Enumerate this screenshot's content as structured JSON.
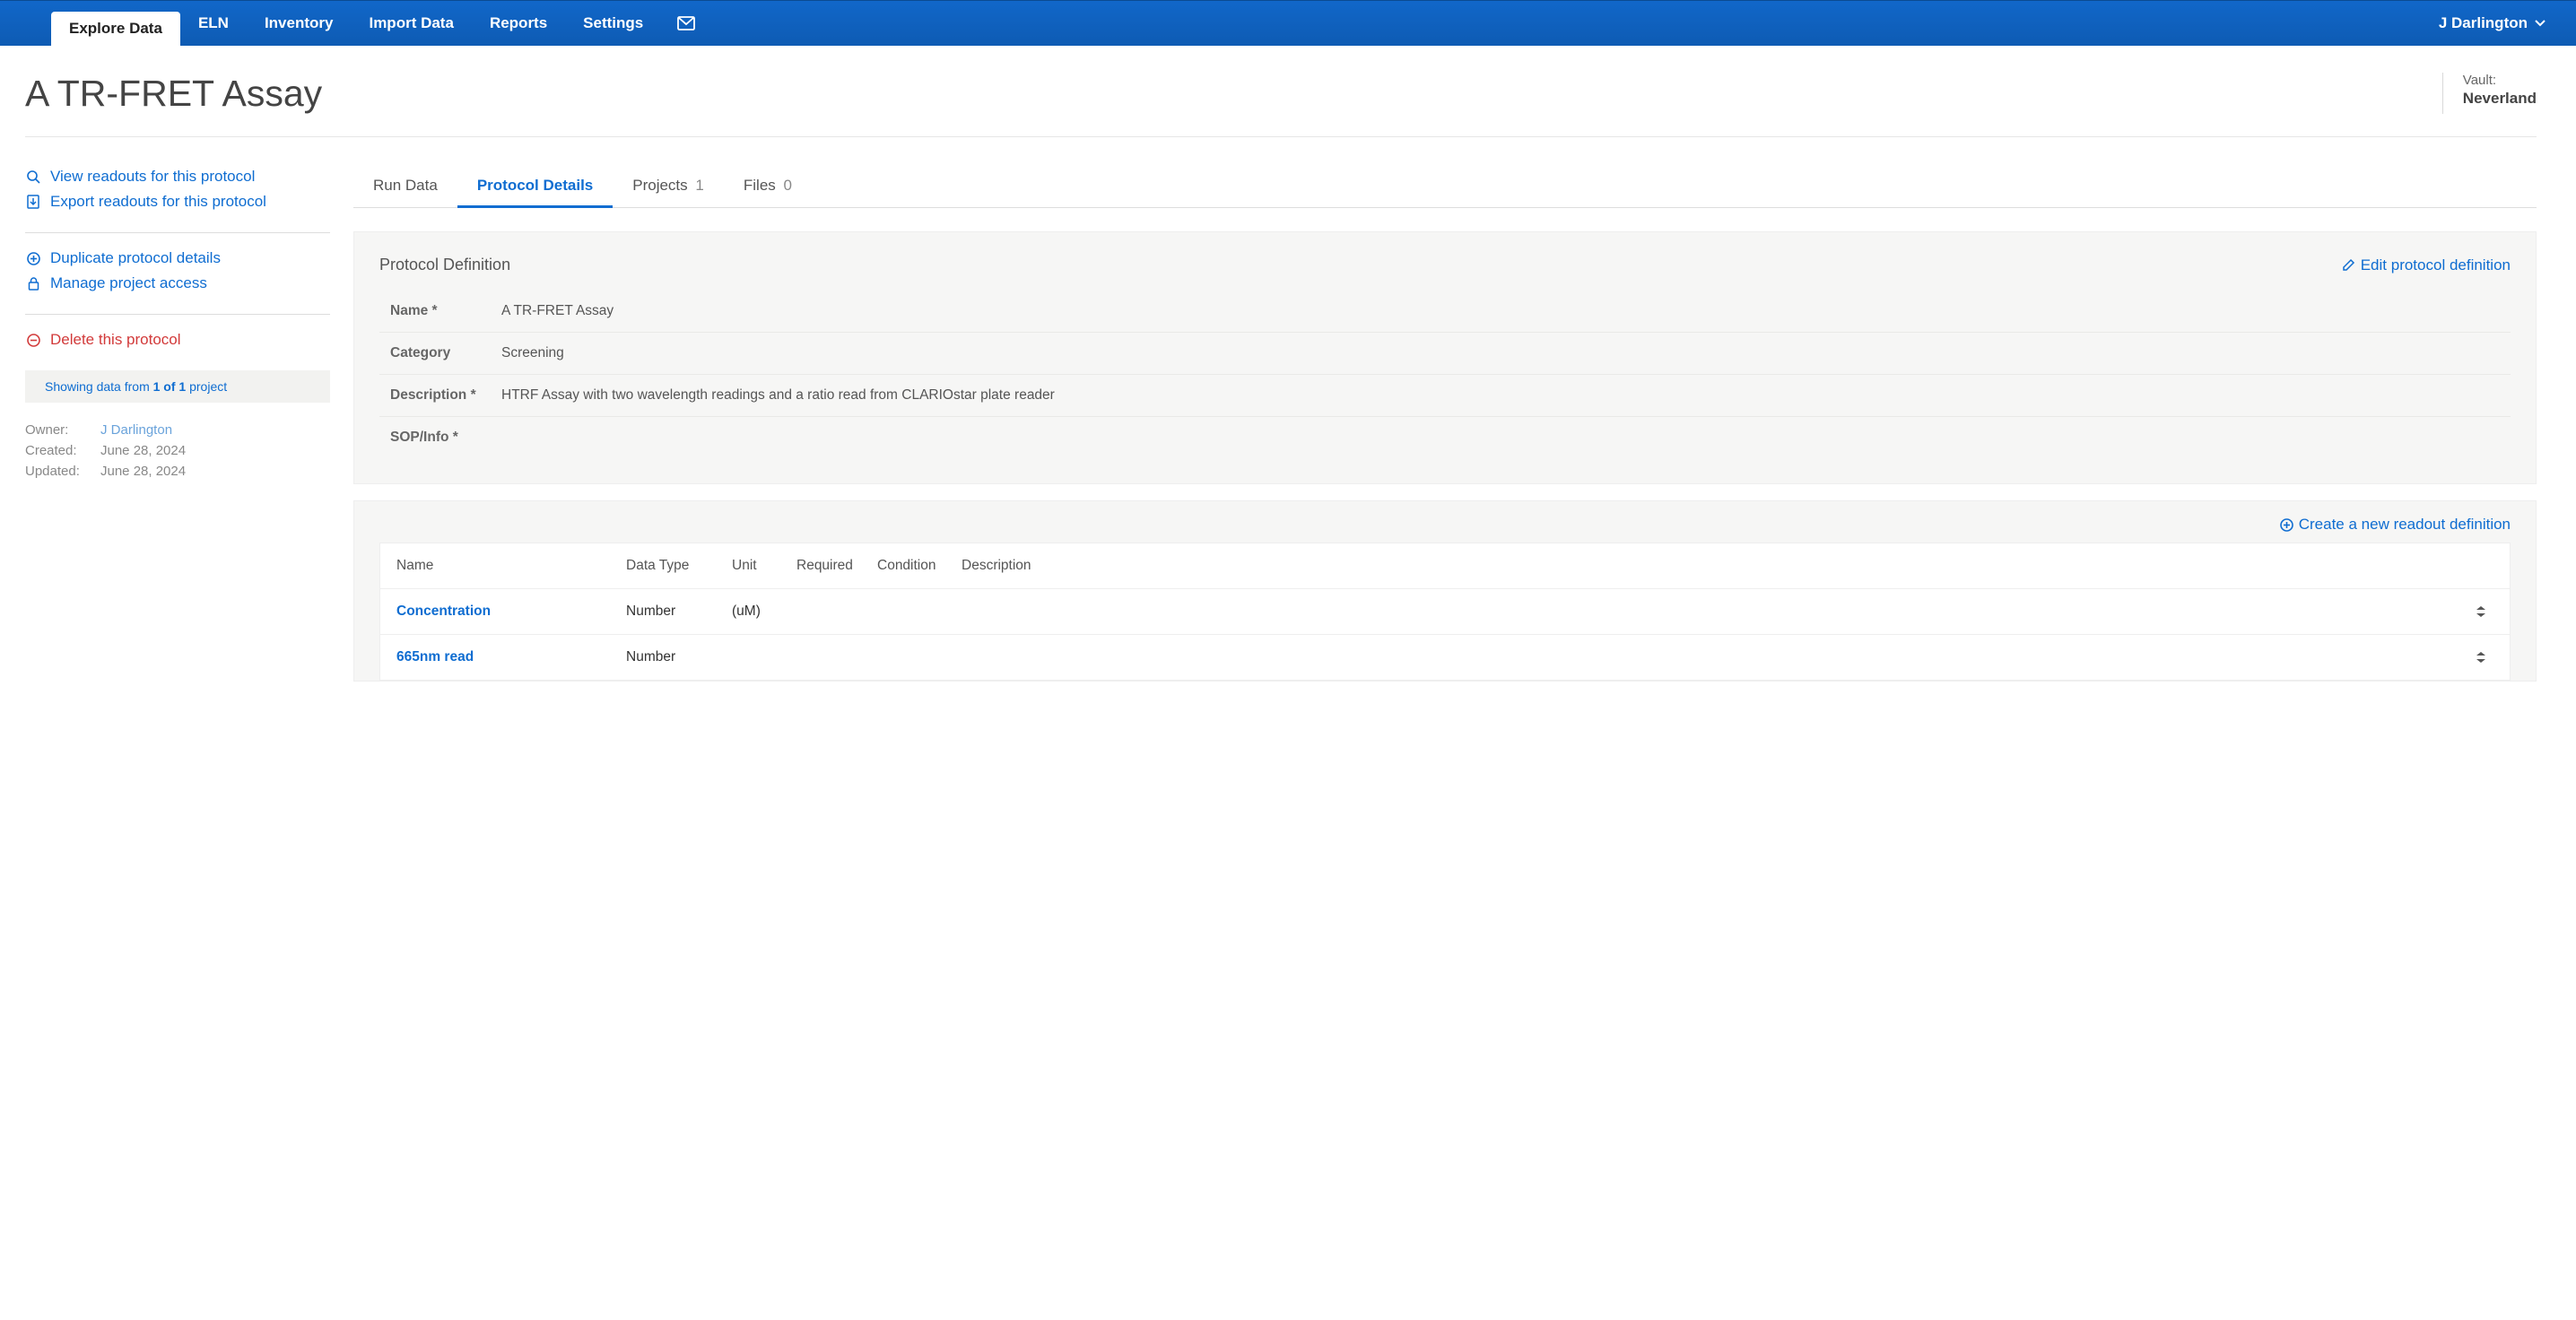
{
  "nav": {
    "items": [
      {
        "label": "Explore Data"
      },
      {
        "label": "ELN"
      },
      {
        "label": "Inventory"
      },
      {
        "label": "Import Data"
      },
      {
        "label": "Reports"
      },
      {
        "label": "Settings"
      }
    ],
    "user": "J Darlington"
  },
  "page": {
    "title": "A TR-FRET Assay",
    "vault_label": "Vault:",
    "vault_name": "Neverland"
  },
  "sidebar": {
    "view_readouts": "View readouts for this protocol",
    "export_readouts": "Export readouts for this protocol",
    "duplicate": "Duplicate protocol details",
    "manage_access": "Manage project access",
    "delete": "Delete this protocol",
    "info_prefix": "Showing data from ",
    "info_bold": "1 of 1",
    "info_suffix": " project",
    "owner_k": "Owner:",
    "owner_v": "J Darlington",
    "created_k": "Created:",
    "created_v": "June 28, 2024",
    "updated_k": "Updated:",
    "updated_v": "June 28, 2024"
  },
  "tabs": {
    "run_data": "Run Data",
    "protocol_details": "Protocol Details",
    "projects": "Projects",
    "projects_count": "1",
    "files": "Files",
    "files_count": "0"
  },
  "definition": {
    "panel_title": "Protocol Definition",
    "edit_label": "Edit protocol definition",
    "rows": {
      "name_k": "Name *",
      "name_v": "A TR-FRET Assay",
      "category_k": "Category",
      "category_v": "Screening",
      "desc_k": "Description *",
      "desc_v": "HTRF Assay with two wavelength readings and a ratio read from CLARIOstar plate reader",
      "sop_k": "SOP/Info *",
      "sop_v": ""
    }
  },
  "readouts": {
    "create_label": "Create a new readout definition",
    "headers": {
      "name": "Name",
      "dtype": "Data Type",
      "unit": "Unit",
      "req": "Required",
      "cond": "Condition",
      "desc": "Description"
    },
    "rows": [
      {
        "name": "Concentration",
        "dtype": "Number",
        "unit": "(uM)"
      },
      {
        "name": "665nm read",
        "dtype": "Number",
        "unit": ""
      }
    ]
  }
}
